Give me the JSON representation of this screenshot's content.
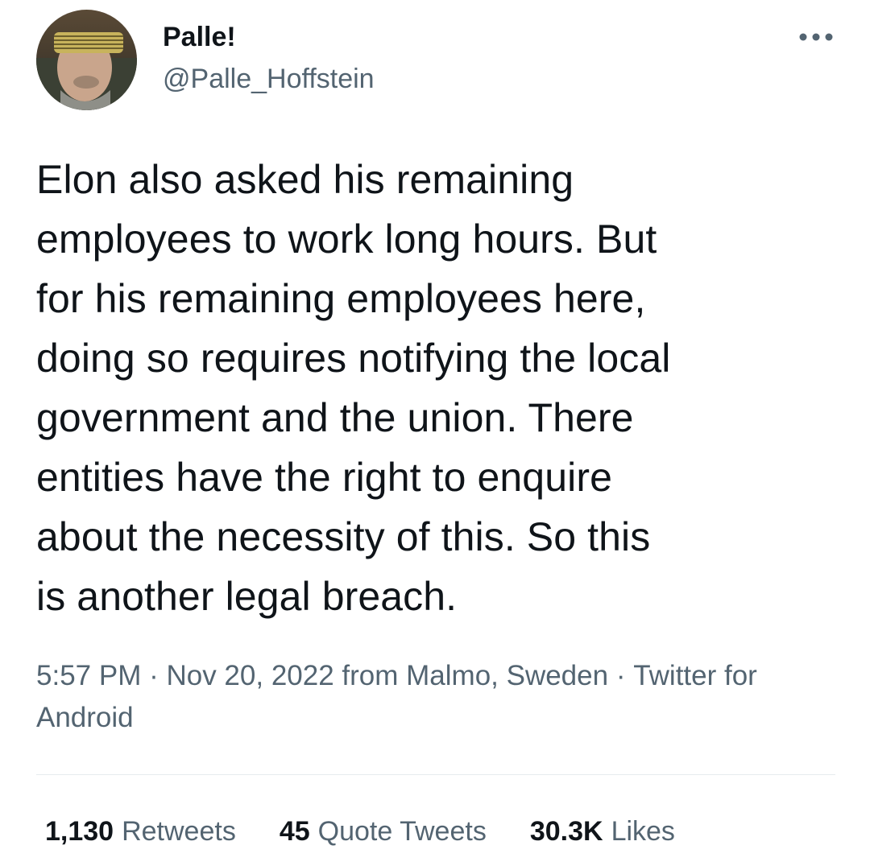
{
  "author": {
    "display_name": "Palle!",
    "handle": "@Palle_Hoffstein",
    "avatar": "avatar-photo-man-with-shutter-shades"
  },
  "menu": {
    "icon": "more-horizontal-icon"
  },
  "tweet": {
    "text": "Elon also asked his remaining\nemployees to work long hours. But\nfor his remaining employees here,\ndoing so requires notifying the local\ngovernment and the union. There\nentities have the right to enquire\nabout the necessity of this. So this\nis another legal breach."
  },
  "meta": {
    "time": "5:57 PM",
    "separator_1": " · ",
    "date": "Nov 20, 2022",
    "location": " from Malmo, Sweden",
    "separator_2": " · ",
    "source": "Twitter for Android"
  },
  "stats": {
    "retweets": {
      "count": "1,130",
      "label": "Retweets"
    },
    "quotes": {
      "count": "45",
      "label": "Quote Tweets"
    },
    "likes": {
      "count": "30.3K",
      "label": "Likes"
    }
  },
  "colors": {
    "text_primary": "#0f1419",
    "text_secondary": "#536471",
    "divider": "#e6ebee"
  }
}
